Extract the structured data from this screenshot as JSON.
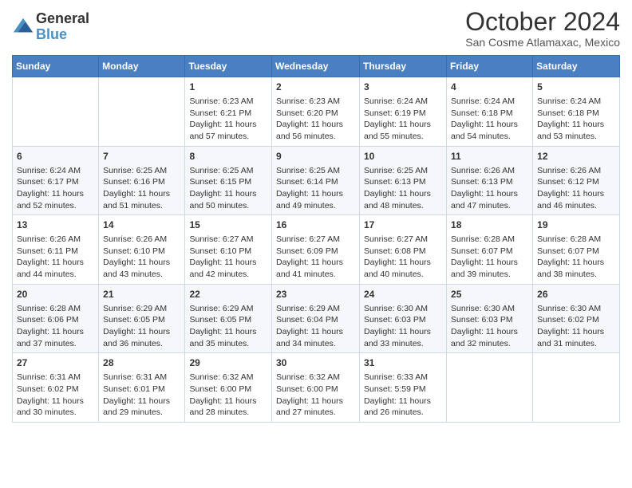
{
  "header": {
    "logo": {
      "general": "General",
      "blue": "Blue"
    },
    "title": "October 2024",
    "location": "San Cosme Atlamaxac, Mexico"
  },
  "calendar": {
    "days_of_week": [
      "Sunday",
      "Monday",
      "Tuesday",
      "Wednesday",
      "Thursday",
      "Friday",
      "Saturday"
    ],
    "weeks": [
      [
        {
          "day": "",
          "content": ""
        },
        {
          "day": "",
          "content": ""
        },
        {
          "day": "1",
          "content": "Sunrise: 6:23 AM\nSunset: 6:21 PM\nDaylight: 11 hours and 57 minutes."
        },
        {
          "day": "2",
          "content": "Sunrise: 6:23 AM\nSunset: 6:20 PM\nDaylight: 11 hours and 56 minutes."
        },
        {
          "day": "3",
          "content": "Sunrise: 6:24 AM\nSunset: 6:19 PM\nDaylight: 11 hours and 55 minutes."
        },
        {
          "day": "4",
          "content": "Sunrise: 6:24 AM\nSunset: 6:18 PM\nDaylight: 11 hours and 54 minutes."
        },
        {
          "day": "5",
          "content": "Sunrise: 6:24 AM\nSunset: 6:18 PM\nDaylight: 11 hours and 53 minutes."
        }
      ],
      [
        {
          "day": "6",
          "content": "Sunrise: 6:24 AM\nSunset: 6:17 PM\nDaylight: 11 hours and 52 minutes."
        },
        {
          "day": "7",
          "content": "Sunrise: 6:25 AM\nSunset: 6:16 PM\nDaylight: 11 hours and 51 minutes."
        },
        {
          "day": "8",
          "content": "Sunrise: 6:25 AM\nSunset: 6:15 PM\nDaylight: 11 hours and 50 minutes."
        },
        {
          "day": "9",
          "content": "Sunrise: 6:25 AM\nSunset: 6:14 PM\nDaylight: 11 hours and 49 minutes."
        },
        {
          "day": "10",
          "content": "Sunrise: 6:25 AM\nSunset: 6:13 PM\nDaylight: 11 hours and 48 minutes."
        },
        {
          "day": "11",
          "content": "Sunrise: 6:26 AM\nSunset: 6:13 PM\nDaylight: 11 hours and 47 minutes."
        },
        {
          "day": "12",
          "content": "Sunrise: 6:26 AM\nSunset: 6:12 PM\nDaylight: 11 hours and 46 minutes."
        }
      ],
      [
        {
          "day": "13",
          "content": "Sunrise: 6:26 AM\nSunset: 6:11 PM\nDaylight: 11 hours and 44 minutes."
        },
        {
          "day": "14",
          "content": "Sunrise: 6:26 AM\nSunset: 6:10 PM\nDaylight: 11 hours and 43 minutes."
        },
        {
          "day": "15",
          "content": "Sunrise: 6:27 AM\nSunset: 6:10 PM\nDaylight: 11 hours and 42 minutes."
        },
        {
          "day": "16",
          "content": "Sunrise: 6:27 AM\nSunset: 6:09 PM\nDaylight: 11 hours and 41 minutes."
        },
        {
          "day": "17",
          "content": "Sunrise: 6:27 AM\nSunset: 6:08 PM\nDaylight: 11 hours and 40 minutes."
        },
        {
          "day": "18",
          "content": "Sunrise: 6:28 AM\nSunset: 6:07 PM\nDaylight: 11 hours and 39 minutes."
        },
        {
          "day": "19",
          "content": "Sunrise: 6:28 AM\nSunset: 6:07 PM\nDaylight: 11 hours and 38 minutes."
        }
      ],
      [
        {
          "day": "20",
          "content": "Sunrise: 6:28 AM\nSunset: 6:06 PM\nDaylight: 11 hours and 37 minutes."
        },
        {
          "day": "21",
          "content": "Sunrise: 6:29 AM\nSunset: 6:05 PM\nDaylight: 11 hours and 36 minutes."
        },
        {
          "day": "22",
          "content": "Sunrise: 6:29 AM\nSunset: 6:05 PM\nDaylight: 11 hours and 35 minutes."
        },
        {
          "day": "23",
          "content": "Sunrise: 6:29 AM\nSunset: 6:04 PM\nDaylight: 11 hours and 34 minutes."
        },
        {
          "day": "24",
          "content": "Sunrise: 6:30 AM\nSunset: 6:03 PM\nDaylight: 11 hours and 33 minutes."
        },
        {
          "day": "25",
          "content": "Sunrise: 6:30 AM\nSunset: 6:03 PM\nDaylight: 11 hours and 32 minutes."
        },
        {
          "day": "26",
          "content": "Sunrise: 6:30 AM\nSunset: 6:02 PM\nDaylight: 11 hours and 31 minutes."
        }
      ],
      [
        {
          "day": "27",
          "content": "Sunrise: 6:31 AM\nSunset: 6:02 PM\nDaylight: 11 hours and 30 minutes."
        },
        {
          "day": "28",
          "content": "Sunrise: 6:31 AM\nSunset: 6:01 PM\nDaylight: 11 hours and 29 minutes."
        },
        {
          "day": "29",
          "content": "Sunrise: 6:32 AM\nSunset: 6:00 PM\nDaylight: 11 hours and 28 minutes."
        },
        {
          "day": "30",
          "content": "Sunrise: 6:32 AM\nSunset: 6:00 PM\nDaylight: 11 hours and 27 minutes."
        },
        {
          "day": "31",
          "content": "Sunrise: 6:33 AM\nSunset: 5:59 PM\nDaylight: 11 hours and 26 minutes."
        },
        {
          "day": "",
          "content": ""
        },
        {
          "day": "",
          "content": ""
        }
      ]
    ]
  }
}
